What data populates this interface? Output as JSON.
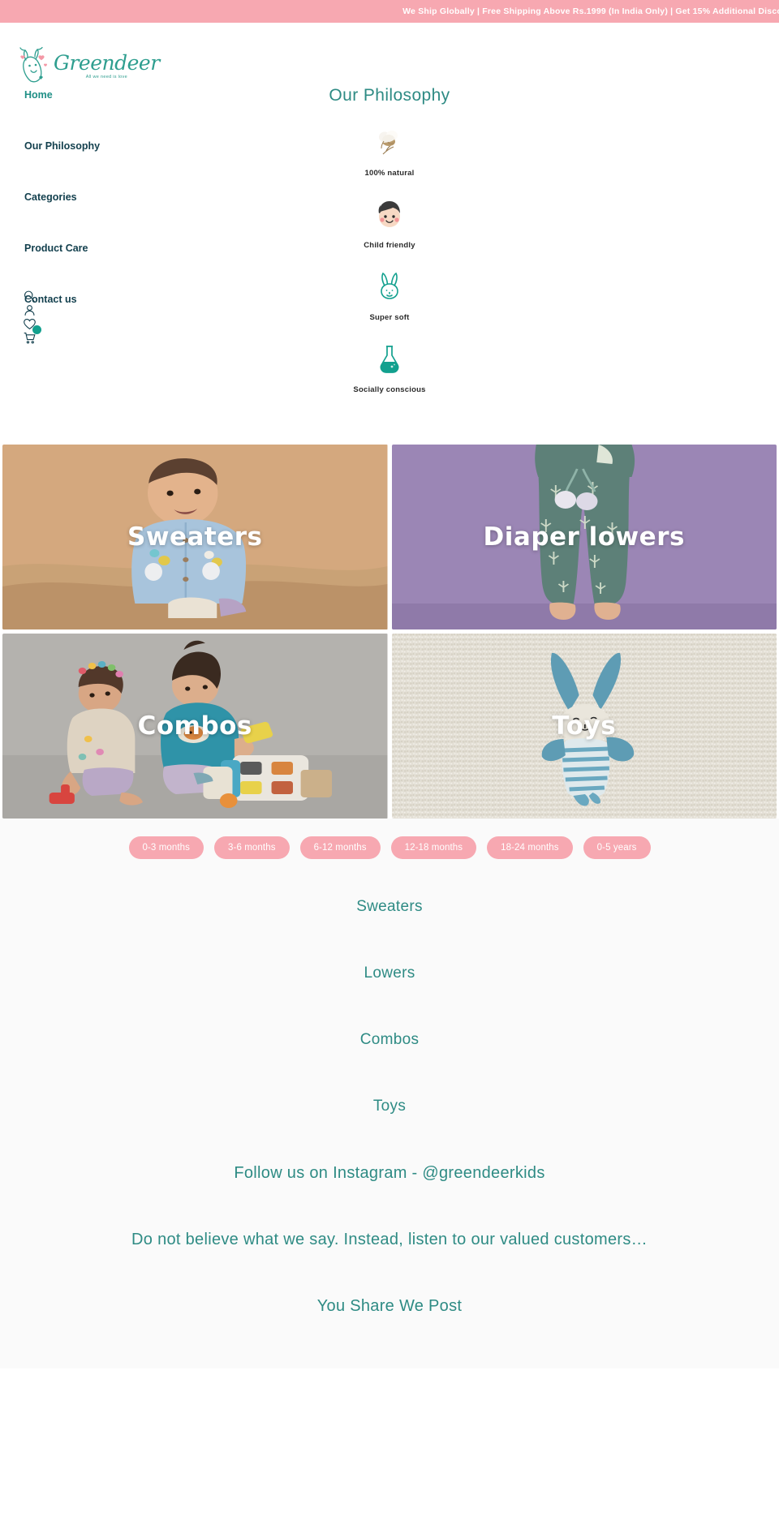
{
  "announcement": {
    "text": "We Ship Globally | Free Shipping Above Rs.1999 (In India Only) | Get 15% Additional Disco"
  },
  "brand": {
    "name": "Greendeer",
    "tagline": "All we need is love"
  },
  "nav": {
    "items": [
      {
        "label": "Home",
        "active": true
      },
      {
        "label": "Our Philosophy",
        "active": false
      },
      {
        "label": "Categories",
        "active": false
      },
      {
        "label": "Product Care",
        "active": false
      },
      {
        "label": "Contact us",
        "active": false
      }
    ]
  },
  "utility_icons": [
    {
      "name": "search-icon"
    },
    {
      "name": "account-icon"
    },
    {
      "name": "wishlist-heart-icon"
    },
    {
      "name": "cart-icon",
      "badge": true
    }
  ],
  "philosophy": {
    "title": "Our Philosophy",
    "items": [
      {
        "label": "100% natural",
        "icon": "cotton-boll-icon"
      },
      {
        "label": "Child friendly",
        "icon": "child-face-icon"
      },
      {
        "label": "Super soft",
        "icon": "bunny-outline-icon"
      },
      {
        "label": "Socially conscious",
        "icon": "flask-icon"
      }
    ]
  },
  "category_tiles": [
    {
      "label": "Sweaters",
      "art": "baby-sweater-photo"
    },
    {
      "label": "Diaper lowers",
      "art": "diaper-lower-photo"
    },
    {
      "label": "Combos",
      "art": "kids-combo-photo"
    },
    {
      "label": "Toys",
      "art": "bunny-toy-photo"
    }
  ],
  "age_filters": [
    "0-3 months",
    "3-6 months",
    "6-12 months",
    "12-18 months",
    "18-24 months",
    "0-5 years"
  ],
  "sections": [
    "Sweaters",
    "Lowers",
    "Combos",
    "Toys",
    "Follow us on Instagram - @greendeerkids",
    "Do not believe what we say. Instead, listen to our valued customers…",
    "You Share We Post"
  ],
  "colors": {
    "pink": "#f7a8b1",
    "teal": "#2e8b84",
    "navy": "#123f4d",
    "badge": "#12a08e"
  }
}
